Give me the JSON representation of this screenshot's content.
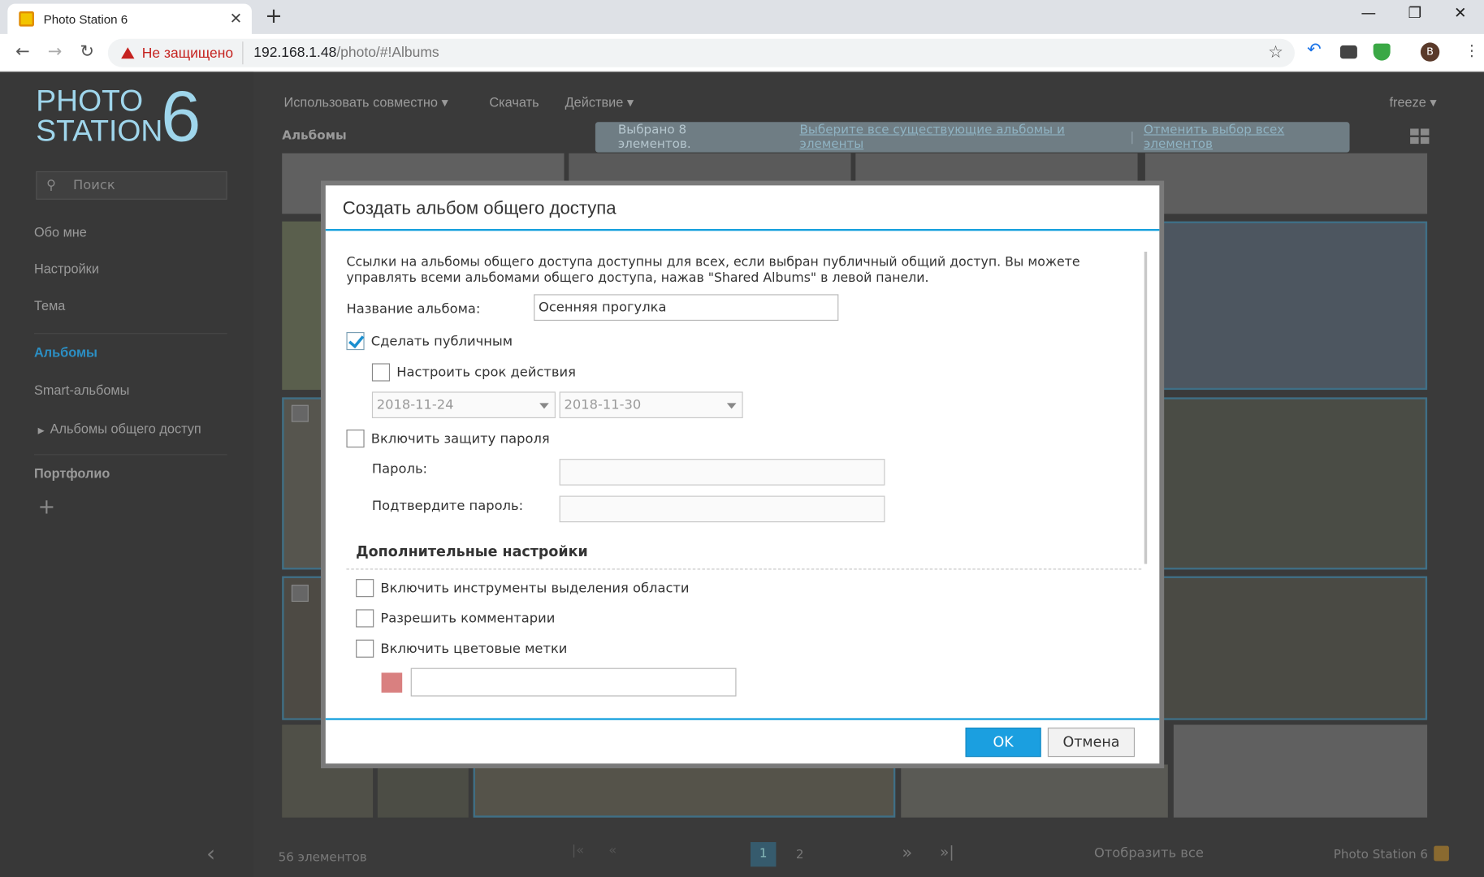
{
  "browser": {
    "tab_title": "Photo Station 6",
    "security_label": "Не защищено",
    "url_host": "192.168.1.48",
    "url_path": "/photo/#!Albums",
    "avatar_letter": "B"
  },
  "app": {
    "logo_line1": "PHOTO",
    "logo_line2": "STATION",
    "logo_number": "6",
    "search_placeholder": "Поиск",
    "sidebar": {
      "about": "Обо мне",
      "settings": "Настройки",
      "theme": "Тема",
      "albums": "Альбомы",
      "smart_albums": "Smart-альбомы",
      "shared_albums": "Альбомы общего доступ",
      "portfolio": "Портфолио",
      "add": "+"
    },
    "topnav": {
      "share": "Использовать совместно",
      "download": "Скачать",
      "action": "Действие",
      "user": "freeze"
    },
    "breadcrumb": "Альбомы",
    "banner": {
      "selected": "Выбрано 8 элементов.",
      "select_all": "Выберите все существующие альбомы и элементы",
      "separator": "|",
      "deselect_all": "Отменить выбор всех элементов"
    },
    "footer": {
      "count": "56 элементов",
      "page1": "1",
      "page2": "2",
      "show_all": "Отобразить все",
      "brand": "Photo Station 6"
    }
  },
  "dialog": {
    "title": "Создать альбом общего доступа",
    "description": "Ссылки на альбомы общего доступа доступны для всех, если выбран публичный общий доступ. Вы можете управлять всеми альбомами общего доступа, нажав \"Shared Albums\" в левой панели.",
    "album_name_label": "Название альбома:",
    "album_name_value": "Осенняя прогулка",
    "make_public_label": "Сделать публичным",
    "make_public_checked": true,
    "set_expiry_label": "Настроить срок действия",
    "date_from": "2018-11-24",
    "date_to": "2018-11-30",
    "password_protect_label": "Включить защиту пароля",
    "password_label": "Пароль:",
    "confirm_password_label": "Подтвердите пароль:",
    "advanced_title": "Дополнительные настройки",
    "region_tools_label": "Включить инструменты выделения области",
    "allow_comments_label": "Разрешить комментарии",
    "color_labels_label": "Включить цветовые метки",
    "color_swatch": "#d98080",
    "ok_label": "OK",
    "cancel_label": "Отмена"
  }
}
